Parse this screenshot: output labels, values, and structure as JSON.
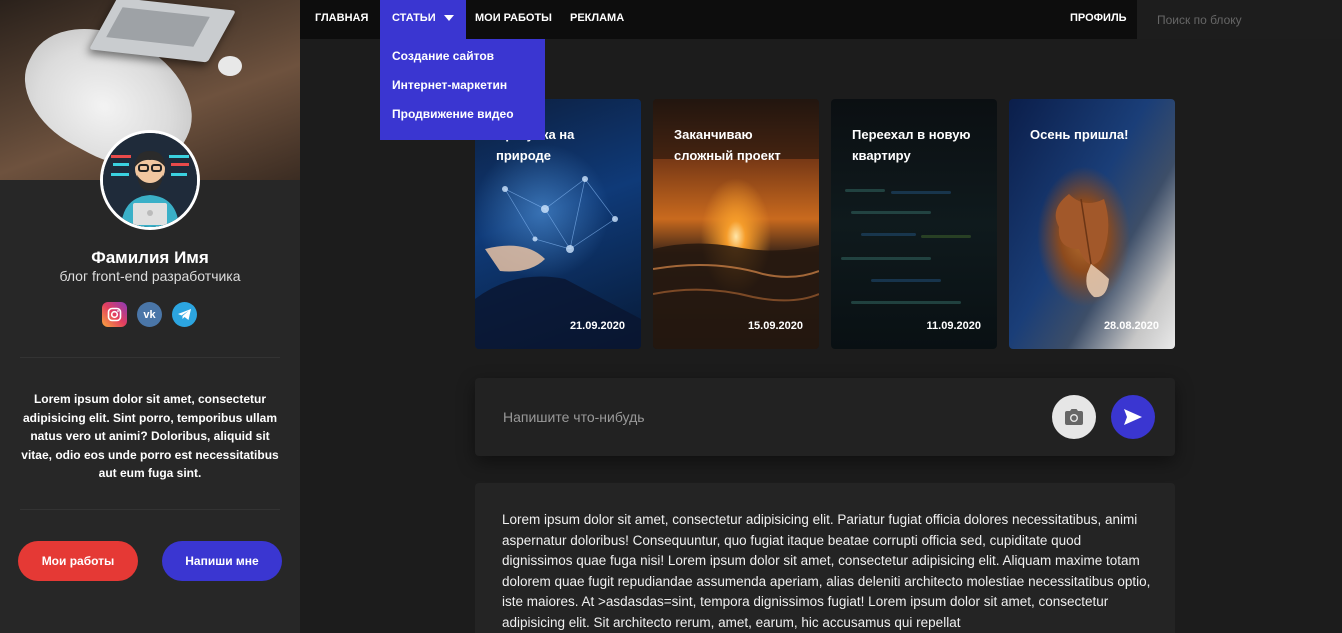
{
  "sidebar": {
    "name": "Фамилия Имя",
    "subtitle": "блог front-end разработчика",
    "socials": [
      {
        "icon": "instagram-icon",
        "label": "IG"
      },
      {
        "icon": "vk-icon",
        "label": "vk"
      },
      {
        "icon": "telegram-icon",
        "label": "tg"
      }
    ],
    "about": "Lorem ipsum dolor sit amet, consectetur adipisicing elit. Sint porro, temporibus ullam natus vero ut animi? Doloribus, aliquid sit vitae, odio eos unde porro est necessitatibus aut eum fuga sint.",
    "btn_works": "Мои работы",
    "btn_write": "Напиши мне"
  },
  "nav": {
    "home": "ГЛАВНАЯ",
    "articles": "СТАТЬИ",
    "works": "МОИ РАБОТЫ",
    "ads": "РЕКЛАМА",
    "profile": "ПРОФИЛЬ",
    "search_placeholder": "Поиск по блоку",
    "dropdown": [
      "Создание сайтов",
      "Интернет-маркетин",
      "Продвижение видео"
    ]
  },
  "stories": [
    {
      "title": "Прогулка на природе",
      "date": "21.09.2020"
    },
    {
      "title": "Заканчиваю сложный проект",
      "date": "15.09.2020"
    },
    {
      "title": "Переехал в новую квартиру",
      "date": "11.09.2020"
    },
    {
      "title": "Осень пришла!",
      "date": "28.08.2020"
    }
  ],
  "composer": {
    "placeholder": "Напишите что-нибудь",
    "camera_icon": "camera-icon",
    "send_icon": "send-icon"
  },
  "post": {
    "text": "Lorem ipsum dolor sit amet, consectetur adipisicing elit. Pariatur fugiat officia dolores necessitatibus, animi aspernatur doloribus! Consequuntur, quo fugiat itaque beatae corrupti officia sed, cupiditate quod dignissimos quae fuga nisi! Lorem ipsum dolor sit amet, consectetur adipisicing elit. Aliquam maxime totam dolorem quae fugit repudiandae assumenda aperiam, alias deleniti architecto molestiae necessitatibus optio, iste maiores. At >asdasdas=sint, tempora dignissimos fugiat! Lorem ipsum dolor sit amet, consectetur adipisicing elit. Sit architecto rerum, amet, earum, hic accusamus qui repellat"
  },
  "colors": {
    "accent": "#3a36d1",
    "danger": "#e53935",
    "background": "#1c1c1c",
    "sidebar": "#272727",
    "nav": "#0d0d0d"
  }
}
